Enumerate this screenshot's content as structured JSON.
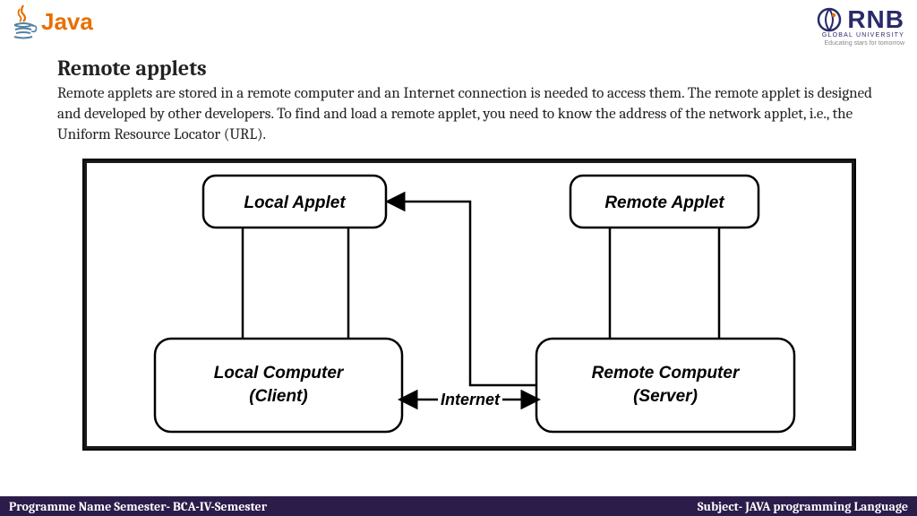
{
  "logos": {
    "java_text": "Java",
    "rnb_text": "RNB",
    "rnb_sub": "GLOBAL UNIVERSITY",
    "rnb_tag": "Educating stars for tomorrow"
  },
  "title": "Remote applets",
  "body": "Remote applets are stored in a remote computer and an Internet connection is needed to access them. The remote applet is designed and developed by other developers. To find and load a remote applet, you need to know the address of the network applet, i.e., the Uniform Resource Locator (URL).",
  "diagram": {
    "local_applet": "Local Applet",
    "remote_applet": "Remote Applet",
    "local_computer_l1": "Local Computer",
    "local_computer_l2": "(Client)",
    "remote_computer_l1": "Remote Computer",
    "remote_computer_l2": "(Server)",
    "internet": "Internet"
  },
  "footer": {
    "left": "Programme Name Semester- BCA-IV-Semester",
    "right": "Subject- JAVA programming Language"
  }
}
